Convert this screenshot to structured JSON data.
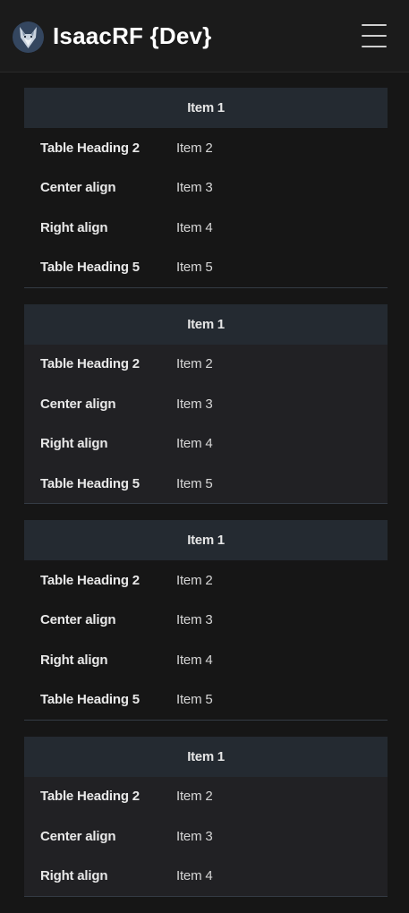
{
  "header": {
    "brand": "IsaacRF {Dev}",
    "logo_icon": "wolf-logo-icon",
    "menu_icon": "hamburger-menu-icon"
  },
  "tables": [
    {
      "header": "Item 1",
      "rows": [
        {
          "heading": "Table Heading 2",
          "value": "Item 2"
        },
        {
          "heading": "Center align",
          "value": "Item 3"
        },
        {
          "heading": "Right align",
          "value": "Item 4"
        },
        {
          "heading": "Table Heading 5",
          "value": "Item 5"
        }
      ]
    },
    {
      "header": "Item 1",
      "rows": [
        {
          "heading": "Table Heading 2",
          "value": "Item 2"
        },
        {
          "heading": "Center align",
          "value": "Item 3"
        },
        {
          "heading": "Right align",
          "value": "Item 4"
        },
        {
          "heading": "Table Heading 5",
          "value": "Item 5"
        }
      ]
    },
    {
      "header": "Item 1",
      "rows": [
        {
          "heading": "Table Heading 2",
          "value": "Item 2"
        },
        {
          "heading": "Center align",
          "value": "Item 3"
        },
        {
          "heading": "Right align",
          "value": "Item 4"
        },
        {
          "heading": "Table Heading 5",
          "value": "Item 5"
        }
      ]
    },
    {
      "header": "Item 1",
      "rows": [
        {
          "heading": "Table Heading 2",
          "value": "Item 2"
        },
        {
          "heading": "Center align",
          "value": "Item 3"
        },
        {
          "heading": "Right align",
          "value": "Item 4"
        }
      ]
    }
  ]
}
